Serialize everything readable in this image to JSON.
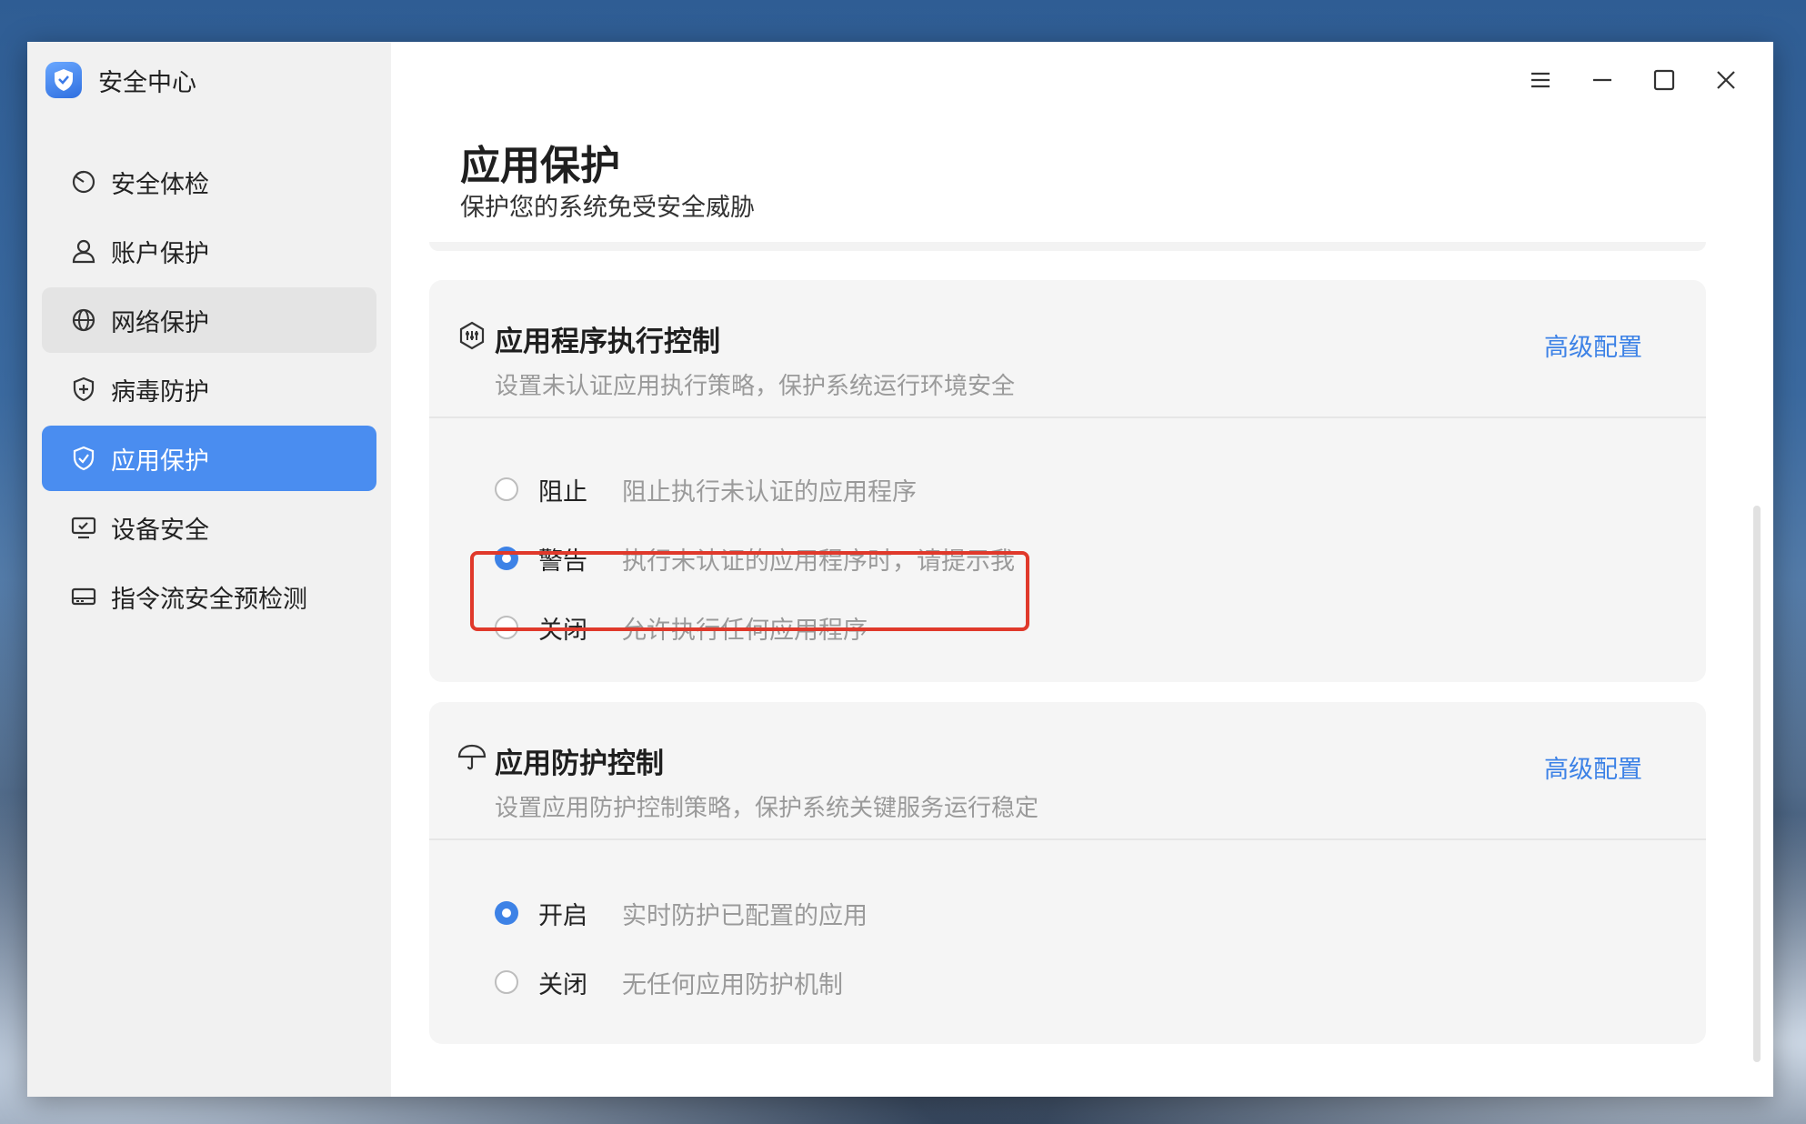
{
  "app": {
    "title": "安全中心"
  },
  "sidebar": {
    "items": [
      {
        "label": "安全体检",
        "icon": "scan-icon"
      },
      {
        "label": "账户保护",
        "icon": "user-icon"
      },
      {
        "label": "网络保护",
        "icon": "globe-icon"
      },
      {
        "label": "病毒防护",
        "icon": "shield-plus-icon"
      },
      {
        "label": "应用保护",
        "icon": "shield-check-icon"
      },
      {
        "label": "设备安全",
        "icon": "monitor-check-icon"
      },
      {
        "label": "指令流安全预检测",
        "icon": "terminal-icon"
      }
    ],
    "active_index": 4,
    "hover_index": 2
  },
  "window_controls": [
    "menu-icon",
    "minimize-icon",
    "maximize-icon",
    "close-icon"
  ],
  "page": {
    "title": "应用保护",
    "subtitle": "保护您的系统免受安全威胁"
  },
  "cards": [
    {
      "title": "应用程序执行控制",
      "description": "设置未认证应用执行策略，保护系统运行环境安全",
      "link": "高级配置",
      "icon": "app-control-icon",
      "options": [
        {
          "label": "阻止",
          "description": "阻止执行未认证的应用程序",
          "checked": false
        },
        {
          "label": "警告",
          "description": "执行未认证的应用程序时，请提示我",
          "checked": true
        },
        {
          "label": "关闭",
          "description": "允许执行任何应用程序",
          "checked": false
        }
      ]
    },
    {
      "title": "应用防护控制",
      "description": "设置应用防护控制策略，保护系统关键服务运行稳定",
      "link": "高级配置",
      "icon": "umbrella-icon",
      "options": [
        {
          "label": "开启",
          "description": "实时防护已配置的应用",
          "checked": true
        },
        {
          "label": "关闭",
          "description": "无任何应用防护机制",
          "checked": false
        }
      ]
    }
  ],
  "colors": {
    "accent": "#3d82e6",
    "active_nav": "#4a8df0",
    "highlight": "#e0392b"
  }
}
